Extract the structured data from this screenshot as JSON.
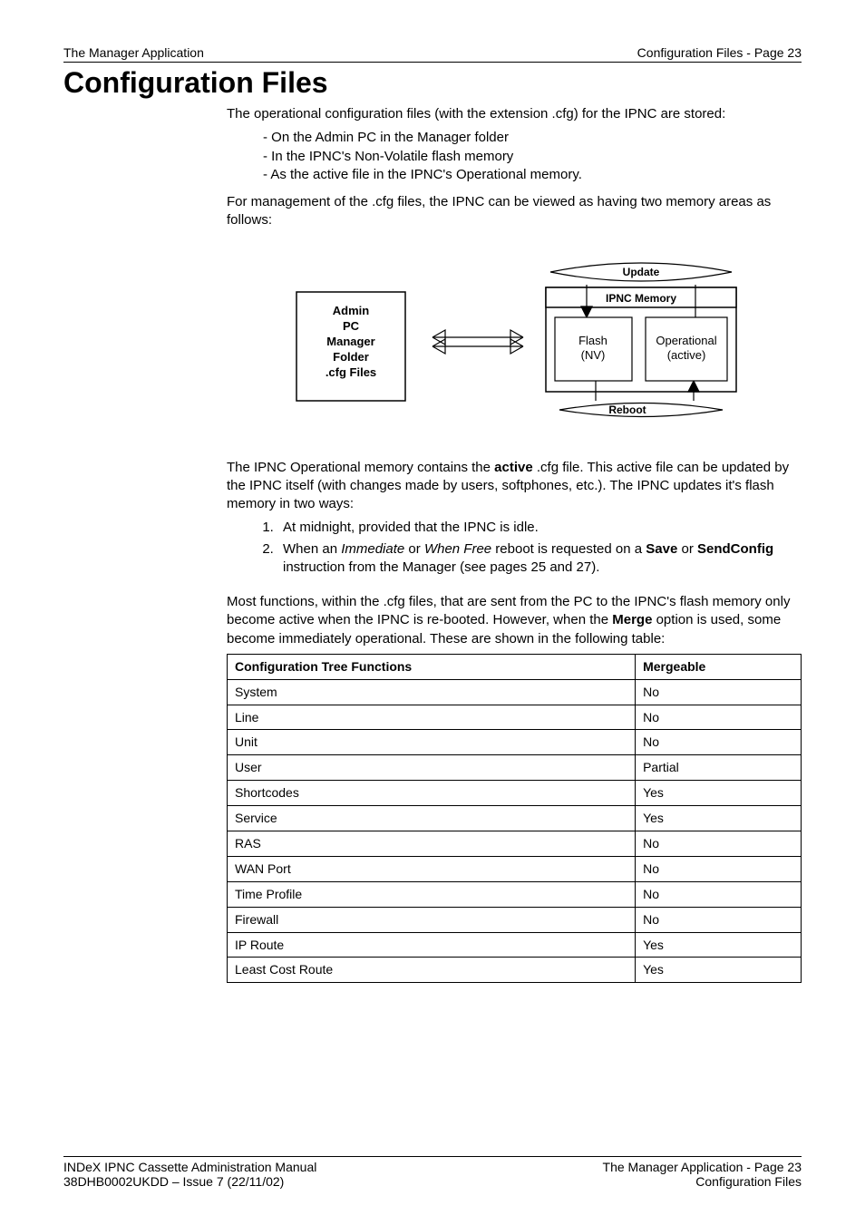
{
  "header": {
    "left": "The Manager Application",
    "right": "Configuration Files - Page 23"
  },
  "title": "Configuration Files",
  "intro": "The operational configuration files (with the extension .cfg) for the IPNC are stored:",
  "stored_list": [
    "On the Admin PC in the Manager folder",
    "In the IPNC's Non-Volatile flash memory",
    "As the active file in the IPNC's Operational memory."
  ],
  "para_mgmt": "For management of the .cfg files, the IPNC can be viewed as having two memory areas as follows:",
  "diagram": {
    "admin_lines": [
      "Admin",
      "PC",
      "Manager",
      "Folder",
      ".cfg Files"
    ],
    "update": "Update",
    "ipnc_memory": "IPNC Memory",
    "flash": "Flash",
    "nv": "(NV)",
    "operational": "Operational",
    "active": "(active)",
    "reboot": "Reboot"
  },
  "para_active_pre": "The IPNC Operational memory contains the ",
  "para_active_bold": "active",
  "para_active_post": " .cfg file. This active file can be updated by the IPNC itself (with changes made by users, softphones, etc.). The IPNC updates it's flash memory in two ways:",
  "ways_list": {
    "item1": "At midnight, provided that the IPNC is idle.",
    "item2_pre": "When an ",
    "item2_i1": "Immediate",
    "item2_mid": " or ",
    "item2_i2": "When Free",
    "item2_mid2": " reboot is requested on a ",
    "item2_b1": "Save",
    "item2_mid3": " or ",
    "item2_b2": "SendConfig",
    "item2_post": " instruction from the Manager (see pages 25 and 27)."
  },
  "para_merge_pre": "Most functions, within the .cfg files, that are sent from the PC to the IPNC's flash memory only become active when the IPNC is re-booted. However, when the ",
  "para_merge_bold": "Merge",
  "para_merge_post": " option is used, some become immediately operational. These are shown in the following table:",
  "table": {
    "headers": [
      "Configuration Tree Functions",
      "Mergeable"
    ],
    "rows": [
      [
        "System",
        "No"
      ],
      [
        "Line",
        "No"
      ],
      [
        "Unit",
        "No"
      ],
      [
        "User",
        "Partial"
      ],
      [
        "Shortcodes",
        "Yes"
      ],
      [
        "Service",
        "Yes"
      ],
      [
        "RAS",
        "No"
      ],
      [
        "WAN Port",
        "No"
      ],
      [
        "Time Profile",
        "No"
      ],
      [
        "Firewall",
        "No"
      ],
      [
        "IP Route",
        "Yes"
      ],
      [
        "Least Cost Route",
        "Yes"
      ]
    ]
  },
  "footer": {
    "left1": "INDeX IPNC Cassette Administration Manual",
    "left2": "38DHB0002UKDD – Issue 7 (22/11/02)",
    "right1": "The Manager Application - Page 23",
    "right2": "Configuration Files"
  }
}
